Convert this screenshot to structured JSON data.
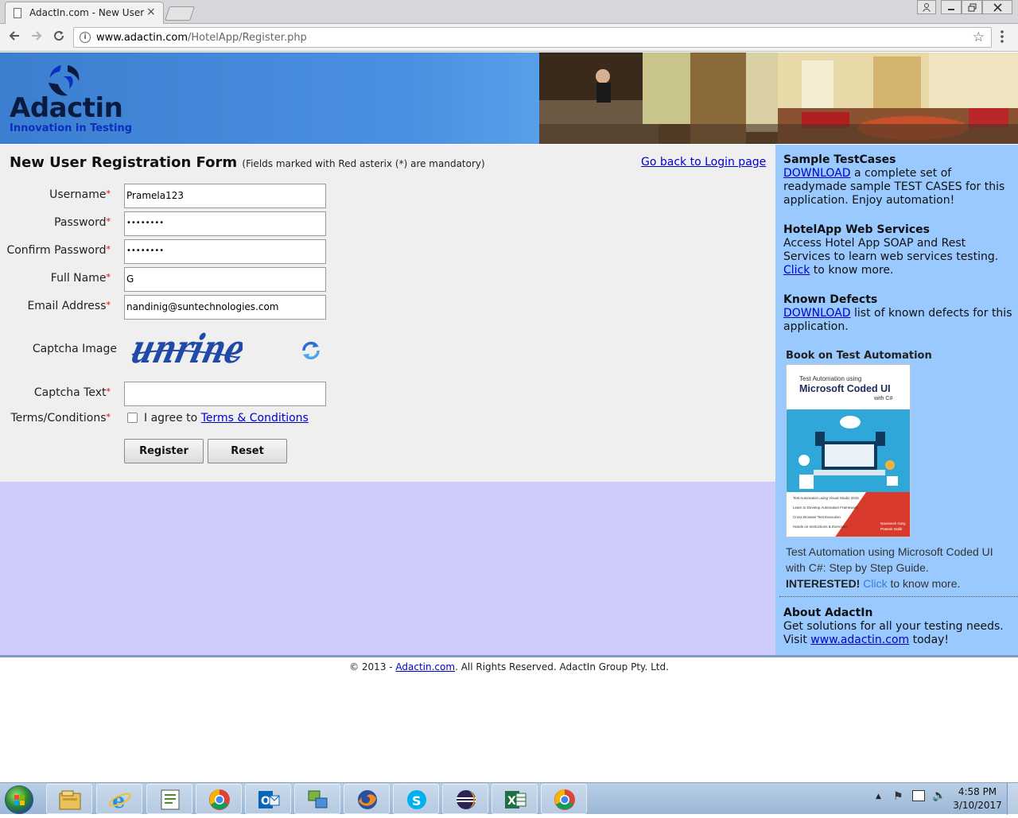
{
  "browser": {
    "tab_title": "AdactIn.com - New User",
    "tab_close": "×",
    "url_host": "www.adactin.com",
    "url_path": "/HotelApp/Register.php"
  },
  "header": {
    "logo_name": "Adactin",
    "logo_tagline": "Innovation in Testing"
  },
  "form": {
    "title": "New User Registration Form",
    "note": "(Fields marked with Red asterix (*) are mandatory)",
    "back_link": "Go back to Login page",
    "required_mark": "*",
    "fields": {
      "username": {
        "label": "Username",
        "value": "Pramela123"
      },
      "password": {
        "label": "Password",
        "value": "••••••••"
      },
      "confirm_password": {
        "label": "Confirm Password",
        "value": "••••••••"
      },
      "full_name": {
        "label": "Full Name",
        "value": "G"
      },
      "email": {
        "label": "Email Address",
        "value": "nandinig@suntechnologies.com"
      },
      "captcha_image": {
        "label": "Captcha Image",
        "captcha_word": "unrine"
      },
      "captcha_text": {
        "label": "Captcha Text",
        "value": ""
      },
      "terms": {
        "label": "Terms/Conditions",
        "agree_text": "I agree to",
        "link_text": "Terms & Conditions",
        "checked": false
      }
    },
    "buttons": {
      "register": "Register",
      "reset": "Reset"
    }
  },
  "sidebar": {
    "testcases": {
      "heading": "Sample TestCases",
      "link": "DOWNLOAD",
      "text": " a complete set of readymade sample TEST CASES for this application. Enjoy automation!"
    },
    "webservices": {
      "heading": "HotelApp Web Services",
      "text": "Access Hotel App SOAP and Rest Services to learn web services testing. ",
      "link": "Click",
      "text_after": " to know more."
    },
    "defects": {
      "heading": "Known Defects",
      "link": "DOWNLOAD",
      "text": " list of known defects for this application."
    },
    "book": {
      "heading": "Book on Test Automation",
      "cover_subtitle": "Test Automation using",
      "cover_title": "Microsoft Coded UI",
      "cover_with": "with C#",
      "cover_bullets": [
        "Test Automation using Visual Studio 2015",
        "Learn to Develop Automation Framework",
        "Cross Browser Test Execution",
        "Hands on Instructions & Exercises"
      ],
      "cover_authors": "Navneesh Garg\nPrateek Malik",
      "description": "Test Automation using Microsoft Coded UI with C#: Step by Step Guide.",
      "interested": "INTERESTED!",
      "link": "Click",
      "text_after": " to know more."
    },
    "about": {
      "heading": "About AdactIn",
      "text": "Get solutions for all your testing needs. Visit ",
      "link": "www.adactin.com",
      "text_after": " today!"
    }
  },
  "footer": {
    "prefix": "© 2013 - ",
    "link": "Adactin.com",
    "suffix": ". All Rights Reserved. AdactIn Group Pty. Ltd."
  },
  "taskbar": {
    "items": [
      "explorer-icon",
      "ie-icon",
      "editor-icon",
      "chrome-icon",
      "outlook-icon",
      "vmware-icon",
      "firefox-icon",
      "skype-icon",
      "eclipse-icon",
      "excel-icon",
      "chrome-icon"
    ],
    "time": "4:58 PM",
    "date": "3/10/2017"
  },
  "colors": {
    "sidebar_bg": "#99c9ff",
    "main_bg": "#efefef",
    "lower_bg": "#cccbfa",
    "link": "#0000cc",
    "required": "#dd0000"
  }
}
